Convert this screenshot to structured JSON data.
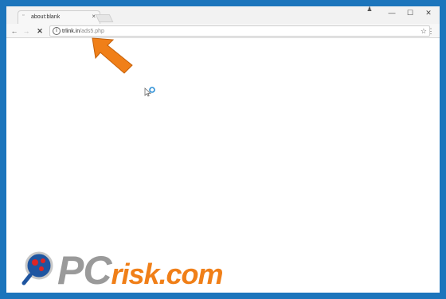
{
  "browser": {
    "tab": {
      "title": "about:blank",
      "close_glyph": "×"
    },
    "window_controls": {
      "minimize": "—",
      "maximize": "☐",
      "close": "✕"
    },
    "nav": {
      "back": "←",
      "forward": "→",
      "stop": "✕"
    },
    "address": {
      "host": "trlink.in",
      "path": "/ads5.php",
      "info_glyph": "i",
      "star_glyph": "☆"
    },
    "menu_glyph": "⋮",
    "user_glyph": "♟"
  },
  "overlay": {
    "arrow_color": "#f07f18",
    "icons": [
      "loading-cursor-icon",
      "arrow-pointer-icon",
      "pcrisk-logo-icon"
    ]
  },
  "watermark": {
    "pc": "PC",
    "risk": "risk.com"
  },
  "colors": {
    "background_border": "#1c75bc",
    "accent_orange": "#f07f18",
    "watermark_gray": "#9a9a9a"
  }
}
